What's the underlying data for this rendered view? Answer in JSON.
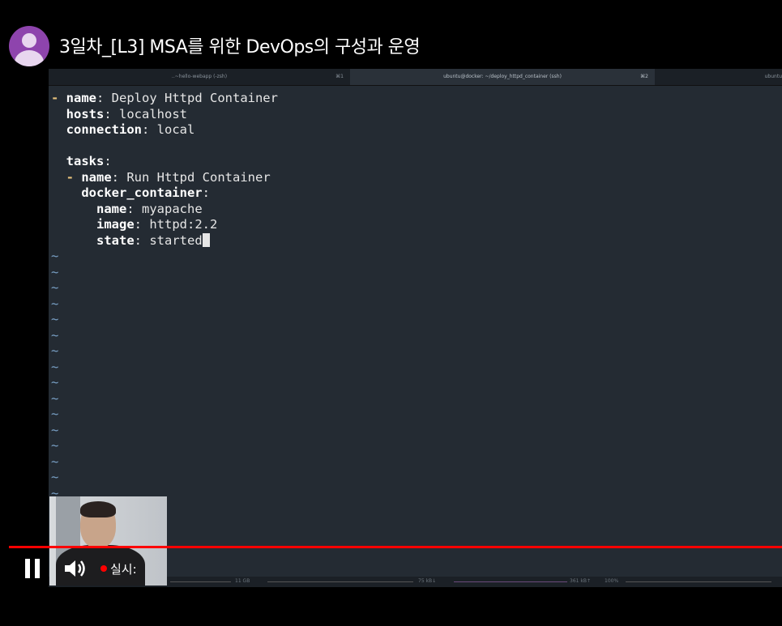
{
  "channel": {
    "avatar_icon": "person-icon",
    "avatar_color": "#8e44ad"
  },
  "title": "3일차_[L3] MSA를 위한 DevOps의 구성과 운영",
  "terminal": {
    "tabs": [
      {
        "label": "..~hello-webapp (-zsh)",
        "shortcut": "⌘1",
        "active": false
      },
      {
        "label": "ubuntu@docker: ~/deploy_httpd_container (ssh)",
        "shortcut": "⌘2",
        "active": true
      },
      {
        "label": "ubuntu",
        "shortcut": "",
        "active": false
      }
    ],
    "lines": [
      {
        "dash": "- ",
        "indent": "",
        "key": "name",
        "value": " Deploy Httpd Container"
      },
      {
        "dash": "",
        "indent": "  ",
        "key": "hosts",
        "value": " localhost"
      },
      {
        "dash": "",
        "indent": "  ",
        "key": "connection",
        "value": " local"
      },
      {
        "dash": "",
        "indent": "",
        "key": "",
        "value": ""
      },
      {
        "dash": "",
        "indent": "  ",
        "key": "tasks",
        "value": ""
      },
      {
        "dash": "- ",
        "indent": "  ",
        "key": "name",
        "value": " Run Httpd Container"
      },
      {
        "dash": "",
        "indent": "    ",
        "key": "docker_container",
        "value": ""
      },
      {
        "dash": "",
        "indent": "      ",
        "key": "name",
        "value": " myapache"
      },
      {
        "dash": "",
        "indent": "      ",
        "key": "image",
        "value": " httpd:2.2"
      },
      {
        "dash": "",
        "indent": "      ",
        "key": "state",
        "value": " started"
      }
    ],
    "tilde_count": 16,
    "status": {
      "disk": "11 GB",
      "net_down": "75 kB↓",
      "net_up": "361 kB↑",
      "battery": "100%"
    }
  },
  "player": {
    "progress_fraction": 1.0,
    "pause_icon": "pause-icon",
    "volume_icon": "volume-icon",
    "live_label": "실시:"
  },
  "colors": {
    "progress": "#ff0000",
    "editor_bg": "#242b33",
    "yaml_dash": "#e5c07b",
    "tilde": "#7aa2c8"
  }
}
